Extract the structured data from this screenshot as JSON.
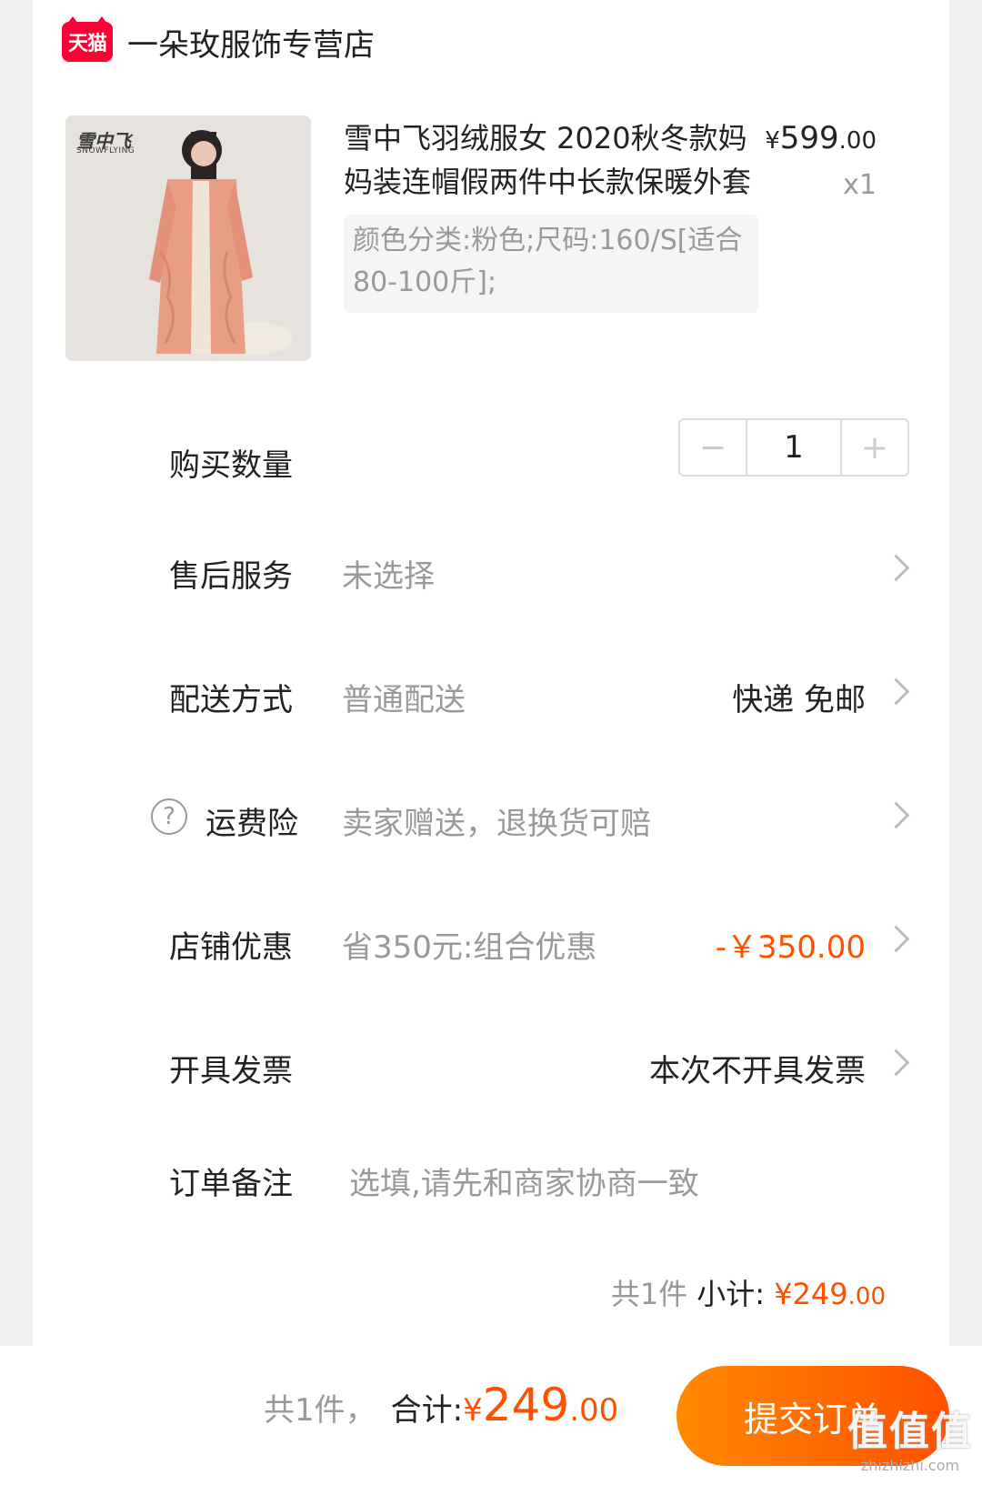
{
  "shop": {
    "badge": "天猫",
    "name": "一朵玫服饰专营店"
  },
  "product": {
    "brand_cn": "雪中飞",
    "brand_en": "SNOWFLYING",
    "title": "雪中飞羽绒服女 2020秋冬款妈妈装连帽假两件中长款保暖外套",
    "price_currency": "¥",
    "price_int": "599",
    "price_dec": ".00",
    "quantity_label": "x1",
    "sku": "颜色分类:粉色;尺码:160/S[适合80-100斤];"
  },
  "rows": {
    "quantity": {
      "label": "购买数量",
      "minus": "−",
      "value": "1",
      "plus": "+"
    },
    "after_sale": {
      "label": "售后服务",
      "value": "未选择"
    },
    "delivery": {
      "label": "配送方式",
      "value": "普通配送",
      "right": "快递 免邮"
    },
    "shipping_insurance": {
      "help": "?",
      "label": "运费险",
      "value": "卖家赠送，退换货可赔"
    },
    "store_discount": {
      "label": "店铺优惠",
      "value": "省350元:组合优惠",
      "right": "-￥350.00"
    },
    "invoice": {
      "label": "开具发票",
      "right": "本次不开具发票"
    },
    "remark": {
      "label": "订单备注",
      "placeholder": "选填,请先和商家协商一致"
    }
  },
  "subtotal": {
    "count": "共1件",
    "label": "小计:",
    "currency": "¥",
    "int": "249",
    "dec": ".00"
  },
  "footer": {
    "count": "共1件，",
    "label": "合计:",
    "currency": "¥",
    "int": "249",
    "dec": ".00",
    "submit": "提交订单"
  },
  "watermark": {
    "glyphs": "值值值",
    "url": "zhizhizhi.com"
  },
  "colors": {
    "accent": "#ff5000",
    "tmall": "#ff0036",
    "gradient_start": "#ff8a00"
  }
}
